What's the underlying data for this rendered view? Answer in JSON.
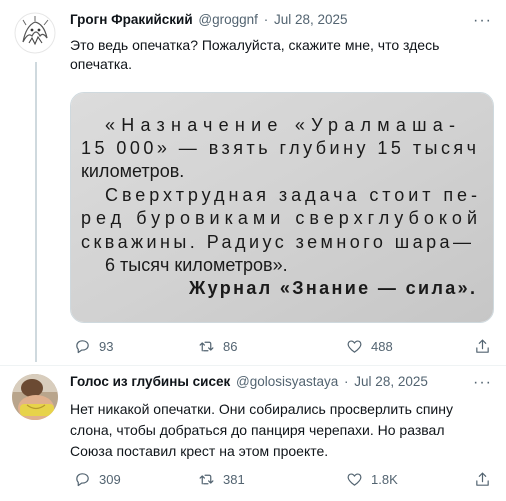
{
  "tweet1": {
    "name": "Грогн Фракийский",
    "handle": "@groggnf",
    "separator": "·",
    "date": "Jul 28, 2025",
    "more": "···",
    "text": "Это ведь опечатка? Пожалуйста, скажите мне, что здесь опечатка.",
    "image": {
      "lines": [
        "«Назначение «Уралмаша-",
        "15 000» — взять глубину 15 тысяч",
        "километров.",
        "Сверхтрудная задача стоит пе-",
        "ред буровиками сверхглубокой",
        "скважины. Радиус земного шара—",
        "6 тысяч километров».",
        "Журнал «Знание — сила»."
      ]
    },
    "stats": {
      "replies": "93",
      "retweets": "86",
      "likes": "488"
    }
  },
  "tweet2": {
    "name": "Голос из глубины сисек",
    "handle": "@golosisyastaya",
    "separator": "·",
    "date": "Jul 28, 2025",
    "more": "···",
    "text": "Нет никакой опечатки. Они собирались просверлить спину слона, чтобы добраться до панциря черепахи. Но развал Союза поставил крест на этом проекте.",
    "stats": {
      "replies": "309",
      "retweets": "381",
      "likes": "1.8K"
    }
  }
}
